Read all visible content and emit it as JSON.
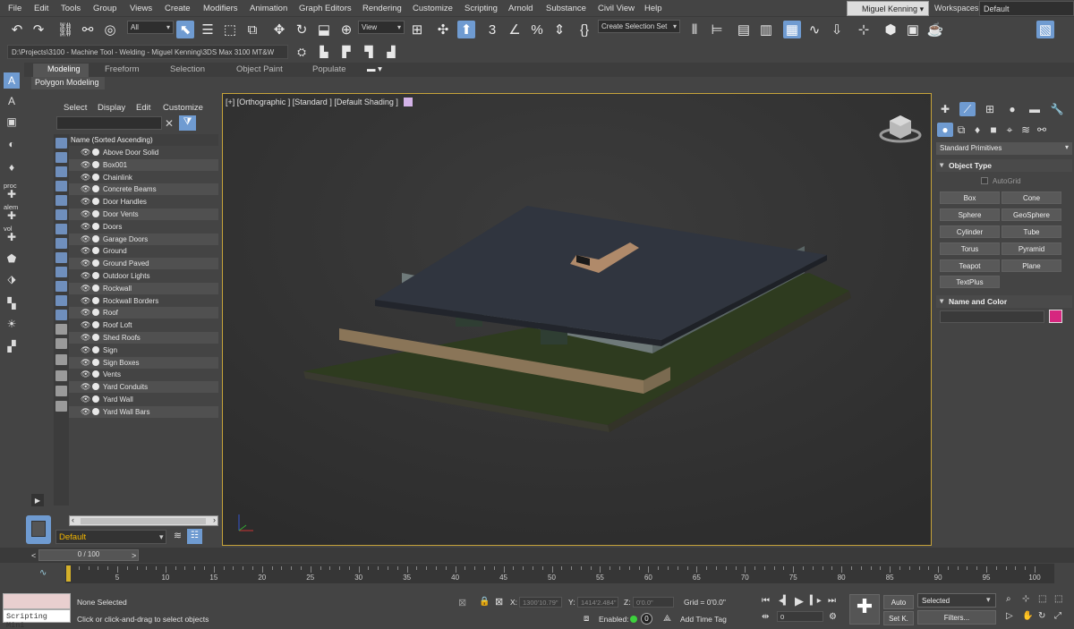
{
  "menu": [
    "File",
    "Edit",
    "Tools",
    "Group",
    "Views",
    "Create",
    "Modifiers",
    "Animation",
    "Graph Editors",
    "Rendering",
    "Customize",
    "Scripting",
    "Arnold",
    "Substance",
    "Civil View",
    "Help"
  ],
  "user": "Miguel Kenning",
  "workspaces": {
    "label": "Workspaces:",
    "value": "Default"
  },
  "toolbar": {
    "filter_select": "All",
    "view_select": "View",
    "selection_set": "Create Selection Set",
    "icons": [
      "undo-icon",
      "redo-icon",
      "link-icon",
      "unlink-icon",
      "bind-spacewarp-icon",
      "select-object-icon",
      "select-by-name-icon",
      "rect-select-icon",
      "window-crossing-icon",
      "move-icon",
      "rotate-icon",
      "scale-icon",
      "placement-icon",
      "pivot-icon",
      "snap-icon",
      "angle-snap-icon",
      "percent-snap-icon",
      "spinner-snap-icon",
      "named-selection-icon",
      "mirror-icon",
      "align-icon",
      "layer-explorer-icon",
      "toggle-ribbon-icon",
      "curve-editor-icon",
      "schematic-icon",
      "material-editor-icon",
      "render-setup-icon",
      "rendered-frame-icon",
      "render-icon",
      "command-panel-toggle-icon"
    ]
  },
  "project_path": "D:\\Projects\\3100 - Machine Tool - Welding - Miguel Kenning\\3DS Max 3100 MT&W",
  "ribbon": {
    "tabs": [
      "Modeling",
      "Freeform",
      "Selection",
      "Object Paint",
      "Populate"
    ],
    "active_tab": "Modeling",
    "sub_tab": "Polygon Modeling"
  },
  "left_strip_labels": [
    "proc",
    "alem",
    "vol"
  ],
  "explorer": {
    "menu": [
      "Select",
      "Display",
      "Edit",
      "Customize"
    ],
    "column_header": "Name (Sorted Ascending)",
    "items": [
      "Above Door Solid",
      "Box001",
      "Chainlink",
      "Concrete Beams",
      "Door Handles",
      "Door Vents",
      "Doors",
      "Garage Doors",
      "Ground",
      "Ground Paved",
      "Outdoor Lights",
      "Rockwall",
      "Rockwall Borders",
      "Roof",
      "Roof Loft",
      "Shed Roofs",
      "Sign",
      "Sign Boxes",
      "Vents",
      "Yard Conduits",
      "Yard Wall",
      "Yard Wall Bars"
    ],
    "layer": "Default"
  },
  "viewport": {
    "label": "[+] [Orthographic ] [Standard ] [Default Shading ]"
  },
  "command_panel": {
    "primitive_select": "Standard Primitives",
    "object_type_title": "Object Type",
    "autogrid": "AutoGrid",
    "buttons": [
      "Box",
      "Cone",
      "Sphere",
      "GeoSphere",
      "Cylinder",
      "Tube",
      "Torus",
      "Pyramid",
      "Teapot",
      "Plane",
      "TextPlus"
    ],
    "name_color_title": "Name and Color",
    "object_color": "#d6267f"
  },
  "timeline": {
    "slider_label": "0 / 100",
    "ticks": [
      0,
      5,
      10,
      15,
      20,
      25,
      30,
      35,
      40,
      45,
      50,
      55,
      60,
      65,
      70,
      75,
      80,
      85,
      90,
      95,
      100
    ]
  },
  "status": {
    "scripting_mini": "Scripting Mini",
    "selection": "None Selected",
    "prompt": "Click or click-and-drag to select objects",
    "x_label": "X:",
    "x_value": "1300'10.79\"",
    "y_label": "Y:",
    "y_value": "1414'2.484\"",
    "z_label": "Z:",
    "z_value": "0'0.0\"",
    "grid": "Grid = 0'0.0\"",
    "enabled": "Enabled:",
    "enabled_value": "0",
    "add_time_tag": "Add Time Tag",
    "auto_key": "Auto",
    "set_key": "Set K.",
    "key_filter_select": "Selected",
    "filters": "Filters...",
    "frame": "0"
  }
}
